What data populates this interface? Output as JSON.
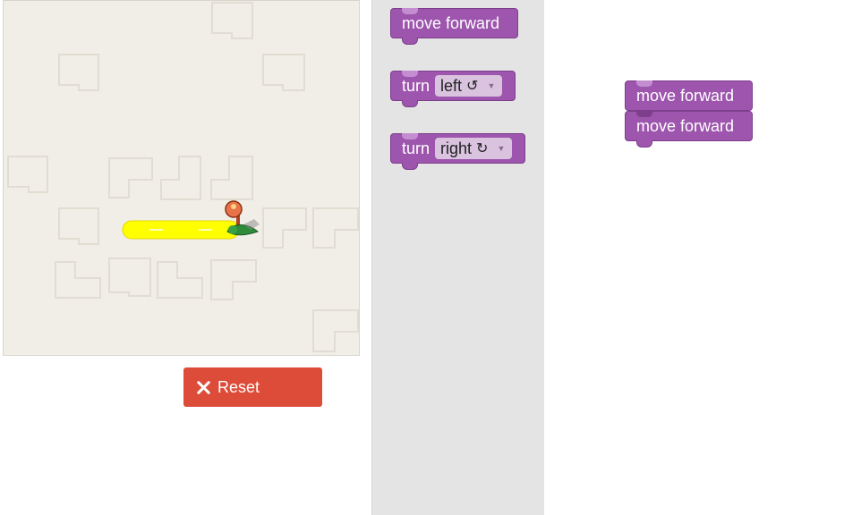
{
  "maze": {
    "player_icon": "pegman-marker-icon",
    "goal_icon": "finish-marker-icon"
  },
  "reset_button": {
    "label": "Reset",
    "icon": "close-icon"
  },
  "toolbox": {
    "blocks": [
      {
        "label": "move forward"
      },
      {
        "label": "turn",
        "dropdown": "left",
        "rot_icon": "↺"
      },
      {
        "label": "turn",
        "dropdown": "right",
        "rot_icon": "↻"
      }
    ]
  },
  "workspace": {
    "blocks": [
      {
        "label": "move forward"
      },
      {
        "label": "move forward"
      }
    ]
  },
  "colors": {
    "block": "#9d55ad",
    "reset": "#dd4b39",
    "path": "#ffff00",
    "maze_bg": "#f1eee7",
    "toolbox_bg": "#e4e4e4"
  }
}
